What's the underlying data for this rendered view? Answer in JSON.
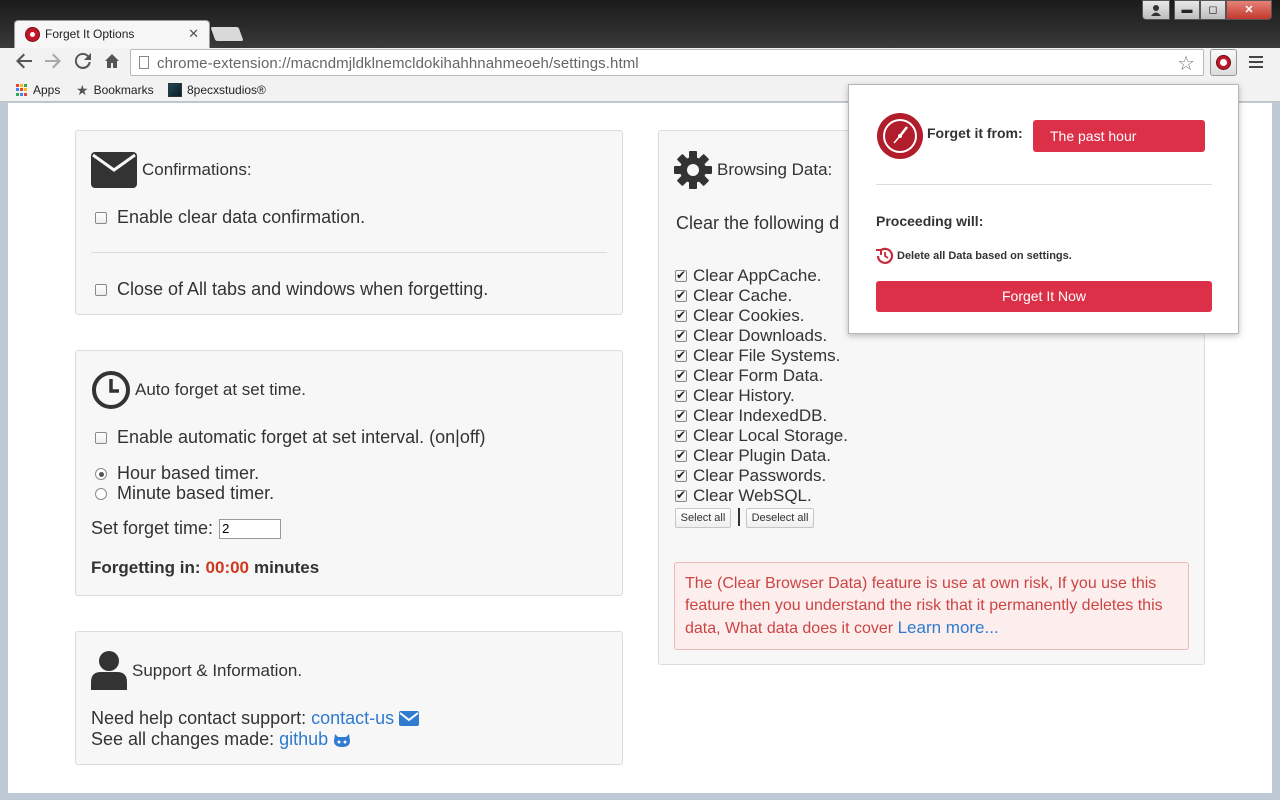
{
  "browser": {
    "tab_title": "Forget It Options",
    "tab_close": "✕",
    "url": "chrome-extension://macndmjldklnemcldokihahhnahmeoeh/settings.html",
    "window_controls": {
      "minimize": "▬",
      "maximize": "◻",
      "close": "✕"
    },
    "bookmarks": [
      {
        "label": "Apps",
        "icon": "apps-grid-icon"
      },
      {
        "label": "Bookmarks",
        "icon": "star-icon"
      },
      {
        "label": "8pecxstudios®",
        "icon": "site-favicon"
      }
    ]
  },
  "confirmations": {
    "title": "Confirmations:",
    "items": [
      {
        "label": "Enable clear data confirmation.",
        "checked": false
      },
      {
        "label": "Close of All tabs and windows when forgetting.",
        "checked": false
      }
    ]
  },
  "auto_forget": {
    "title": "Auto forget at set time.",
    "enable_label": "Enable automatic forget at set interval. (on|off)",
    "radios": [
      {
        "label": "Hour based timer.",
        "checked": true
      },
      {
        "label": "Minute based timer.",
        "checked": false
      }
    ],
    "set_time_label": "Set forget time:",
    "set_time_value": "2",
    "forgetting_prefix": "Forgetting in:",
    "forgetting_time": "00:00",
    "forgetting_suffix": "minutes"
  },
  "support": {
    "title": "Support & Information.",
    "help_text": "Need help contact support:",
    "contact_link": "contact-us",
    "changes_text": "See all changes made:",
    "github_link": "github"
  },
  "browsing_data": {
    "title": "Browsing Data:",
    "subtitle": "Clear the following d",
    "items": [
      "Clear AppCache.",
      "Clear Cache.",
      "Clear Cookies.",
      "Clear Downloads.",
      "Clear File Systems.",
      "Clear Form Data.",
      "Clear History.",
      "Clear IndexedDB.",
      "Clear Local Storage.",
      "Clear Plugin Data.",
      "Clear Passwords.",
      "Clear WebSQL."
    ],
    "select_all": "Select all",
    "deselect_all": "Deselect all",
    "warning_text": "The (Clear Browser Data) feature is use at own risk, If you use this feature then you understand the risk that it permanently deletes this data, What data does it cover",
    "learn_more": "Learn more..."
  },
  "popup": {
    "forget_from_label": "Forget it from:",
    "selected_range": "The past hour",
    "proceeding_label": "Proceeding will:",
    "delete_text": "Delete all Data based on settings.",
    "forget_now": "Forget It Now"
  },
  "colors": {
    "accent_red": "#dc2f48",
    "link_blue": "#2e7bd0",
    "timer_red": "#d0391f"
  }
}
